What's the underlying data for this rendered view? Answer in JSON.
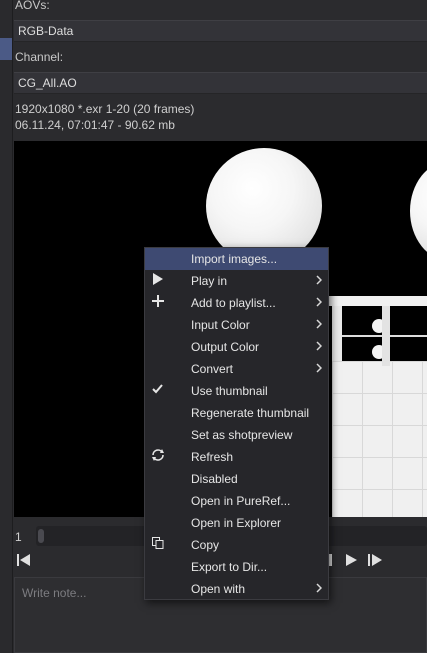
{
  "aovs_label": "AOVs:",
  "aovs_value": "RGB-Data",
  "channel_label": "Channel:",
  "channel_value": "CG_All.AO",
  "info": {
    "line1": "1920x1080   *.exr   1-20 (20 frames)",
    "line2": "06.11.24,  07:01:47 - 90.62 mb"
  },
  "timeline": {
    "frame": "1"
  },
  "note_placeholder": "Write note...",
  "context_menu": {
    "items": [
      {
        "label": "Import images...",
        "icon": "",
        "submenu": false,
        "highlighted": true
      },
      {
        "label": "Play in",
        "icon": "play-icon",
        "submenu": true
      },
      {
        "label": "Add to playlist...",
        "icon": "plus-icon",
        "submenu": true
      },
      {
        "label": "Input Color",
        "icon": "",
        "submenu": true
      },
      {
        "label": "Output Color",
        "icon": "",
        "submenu": true
      },
      {
        "label": "Convert",
        "icon": "",
        "submenu": true
      },
      {
        "label": "Use thumbnail",
        "icon": "check-icon",
        "submenu": false
      },
      {
        "label": "Regenerate thumbnail",
        "icon": "",
        "submenu": false
      },
      {
        "label": "Set as shotpreview",
        "icon": "",
        "submenu": false
      },
      {
        "label": "Refresh",
        "icon": "refresh-icon",
        "submenu": false
      },
      {
        "label": "Disabled",
        "icon": "",
        "submenu": false
      },
      {
        "label": "Open in PureRef...",
        "icon": "",
        "submenu": false
      },
      {
        "label": "Open in Explorer",
        "icon": "",
        "submenu": false
      },
      {
        "label": "Copy",
        "icon": "copy-icon",
        "submenu": false
      },
      {
        "label": "Export to Dir...",
        "icon": "",
        "submenu": false
      },
      {
        "label": "Open with",
        "icon": "",
        "submenu": true
      }
    ]
  },
  "colors": {
    "highlight": "#3e4a72",
    "accent": "#4b5a86"
  }
}
